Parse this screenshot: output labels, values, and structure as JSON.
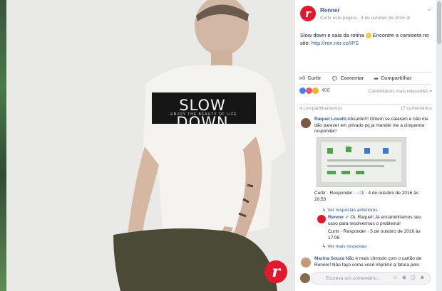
{
  "photo": {
    "shirt_text": "SLOW DOWN",
    "shirt_subtext": "ENJOY THE BEAUTY OF LIFE",
    "badge_letter": "r"
  },
  "post": {
    "avatar_letter": "r",
    "page_name": "Renner",
    "meta_prefix": "Curtir esta página",
    "meta_sep": " · ",
    "date": "4 de outubro de 2016",
    "privacy_icon": "globe-icon",
    "menu_icon": "chevron-down-icon",
    "text": "Slow down e saia da rotina",
    "text_after_emoji": " Encontre a camiseta no site: ",
    "url": "http://ren.ner.co/IPS"
  },
  "actions": {
    "like": "Curtir",
    "comment": "Comentar",
    "share": "Compartilhar"
  },
  "reactions": {
    "count": "406",
    "sort": "Comentários mais relevantes ▾",
    "colors": [
      "#4080ff",
      "#f25268",
      "#f7b125"
    ]
  },
  "stats": {
    "shares": "4 compartilhamentos",
    "comments": "17 comentários"
  },
  "comments": [
    {
      "name": "Raquel Lovatti",
      "text": " Absurdo!!! Ontem se calaram e não me dão parecer em privado pq ja mandei me a cinquenta responder!",
      "actions": "Curtir · Responder · ",
      "likes": "1",
      "date": " · 4 de outubro de 2016 às 20:53"
    },
    {
      "view_more": "Ver respostas anteriores"
    },
    {
      "name": "Renner",
      "text": " Oi, Raquel! Já encaminhamos seu caso para resolvermos o problema!",
      "actions": "Curtir · Responder · ",
      "date": "5 de outubro de 2016 às 17:06"
    },
    {
      "view_more": "Ver mais respostas"
    },
    {
      "name": "Marina Souza",
      "text": " Não é mais cômodo com o cartão de Renner! Não faço como você imprimir a fatura pelo"
    }
  ],
  "composer": {
    "placeholder": "Escreva um comentário...",
    "icons": "☺ ◉ ◫ ☻"
  }
}
